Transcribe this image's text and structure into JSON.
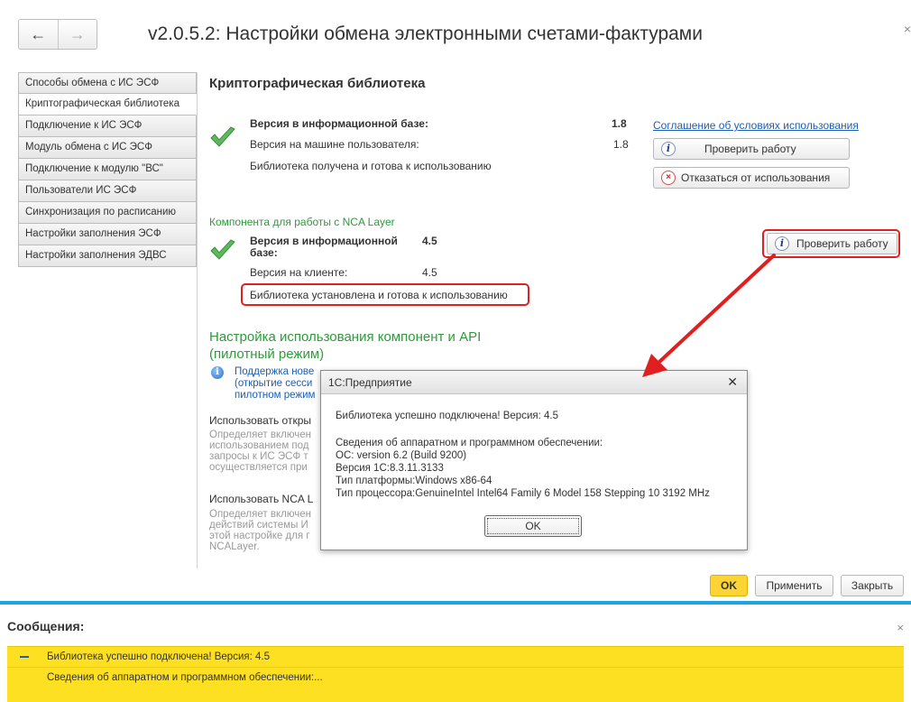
{
  "window": {
    "title": "v2.0.5.2: Настройки обмена электронными счетами-фактурами",
    "back_icon": "←",
    "forward_icon": "→",
    "close_icon": "×"
  },
  "sidebar": {
    "items": [
      {
        "label": "Способы обмена с ИС ЭСФ"
      },
      {
        "label": "Криптографическая библиотека"
      },
      {
        "label": "Подключение к ИС ЭСФ"
      },
      {
        "label": "Модуль обмена с ИС ЭСФ"
      },
      {
        "label": "Подключение к модулю \"ВС\""
      },
      {
        "label": "Пользователи ИС ЭСФ"
      },
      {
        "label": "Синхронизация по расписанию"
      },
      {
        "label": "Настройки заполнения ЭСФ"
      },
      {
        "label": "Настройки заполнения ЭДВС"
      }
    ]
  },
  "crypto": {
    "section_title": "Криптографическая библиотека",
    "db_version_label": "Версия в информационной базе:",
    "db_version_value": "1.8",
    "user_version_label": "Версия на машине пользователя:",
    "user_version_value": "1.8",
    "status": "Библиотека получена и готова к использованию",
    "agreement_link": "Соглашение об условиях использования",
    "check_button": "Проверить работу",
    "refuse_button": "Отказаться от использования"
  },
  "nca": {
    "title": "Компонента для работы с NCA Layer",
    "db_version_label_1": "Версия в информационной",
    "db_version_label_2": "базе:",
    "db_version_value": "4.5",
    "client_version_label": "Версия на клиенте:",
    "client_version_value": "4.5",
    "status": "Библиотека установлена и готова к использованию",
    "check_button": "Проверить работу"
  },
  "api": {
    "title_1": "Настройка использования компонент и API",
    "title_2": "(пилотный режим)",
    "info_1": "Поддержка нове",
    "info_2": "(открытие сесси",
    "info_3": "пилотном режим",
    "use_open": "Использовать откры",
    "desc1_1": "Определяет включен",
    "desc1_2": "использованием под",
    "desc1_3": "запросы к ИС ЭСФ т",
    "desc1_4": "осуществляется при",
    "use_nca": "Использовать NCA L",
    "desc2_1": "Определяет включен",
    "desc2_2": "действий системы И",
    "desc2_3": "этой настройке для г",
    "desc2_4": "NCALayer."
  },
  "dialog": {
    "title": "1С:Предприятие",
    "close": "✕",
    "line1": "Библиотека успешно подключена! Версия: 4.5",
    "line2": "Сведения об аппаратном и программном обеспечении:",
    "line3": "ОС: version 6.2  (Build 9200)",
    "line4": "Версия 1С:8.3.11.3133",
    "line5": "Тип платформы:Windows x86-64",
    "line6": "Тип процессора:GenuineIntel Intel64 Family 6 Model 158 Stepping 10 3192 MHz",
    "ok": "OK"
  },
  "footer": {
    "ok": "OK",
    "apply": "Применить",
    "close": "Закрыть"
  },
  "messages": {
    "title": "Сообщения:",
    "close": "×",
    "items": [
      "Библиотека успешно подключена! Версия: 4.5",
      "Сведения об аппаратном и программном обеспечении:..."
    ]
  },
  "colors": {
    "accent_green": "#2e9a3c",
    "link_blue": "#1a5fb4",
    "highlight_red": "#e02020",
    "ok_yellow": "#fcd535",
    "messages_yellow": "#fce021",
    "divider_blue": "#1ea4e0"
  }
}
